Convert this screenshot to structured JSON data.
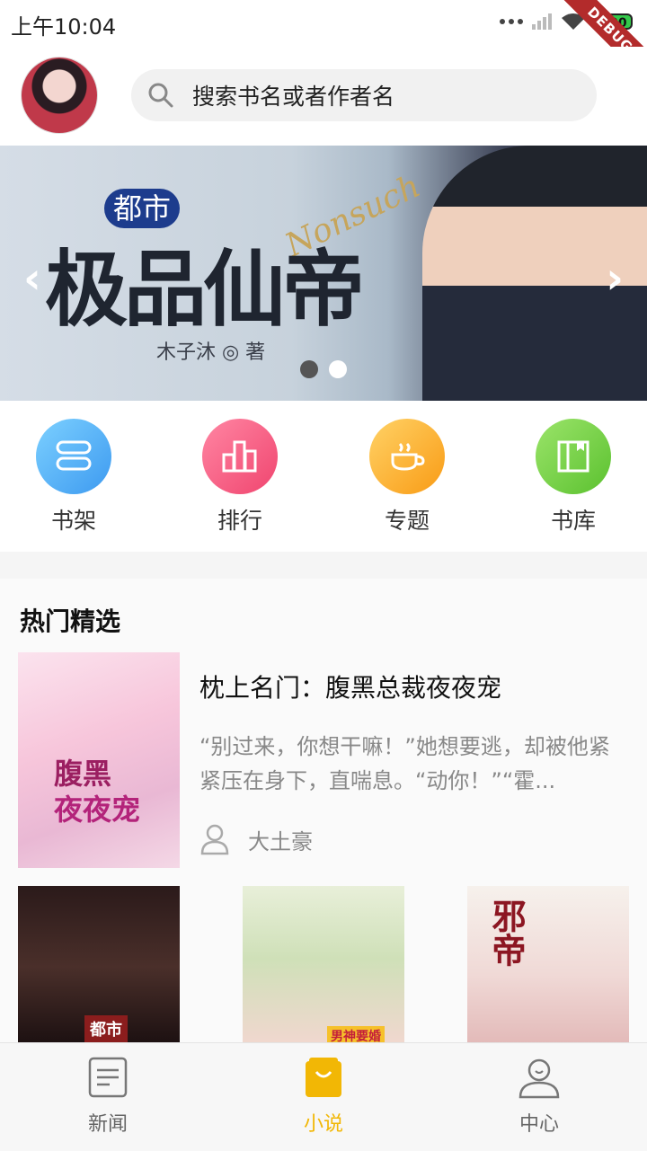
{
  "status_bar": {
    "time": "上午10:04",
    "battery": "100",
    "debug": "DEBUG"
  },
  "search": {
    "placeholder": "搜索书名或者作者名"
  },
  "banner": {
    "tag": "都市",
    "title": "极品仙帝",
    "script_text": "Nonsuch",
    "author": "木子沐 ◎ 著",
    "prev_glyph": "‹",
    "next_glyph": "›",
    "page_count": 2,
    "active_page": 1
  },
  "categories": [
    {
      "label": "书架",
      "icon": "bookshelf-icon",
      "color": "#5fb8f5"
    },
    {
      "label": "排行",
      "icon": "ranking-icon",
      "color": "#f7658a"
    },
    {
      "label": "专题",
      "icon": "coffee-cup-icon",
      "color": "#fbb32b"
    },
    {
      "label": "书库",
      "icon": "library-book-icon",
      "color": "#7dd34a"
    }
  ],
  "hot": {
    "section_title": "热门精选",
    "featured": {
      "name": "枕上名门：腹黑总裁夜夜宠",
      "description": "“别过来，你想干嘛！”她想要逃，却被他紧紧压在身下，直喘息。“动你！”“霍...",
      "author": "大土豪",
      "cover_text_1": "腹黑",
      "cover_text_2": "夜夜宠"
    },
    "covers": [
      {
        "text": "都市"
      },
      {
        "text": "男神要婚"
      },
      {
        "text": "邪帝"
      }
    ]
  },
  "nav": [
    {
      "label": "新闻",
      "icon": "news-icon",
      "active": false
    },
    {
      "label": "小说",
      "icon": "novel-bag-icon",
      "active": true
    },
    {
      "label": "中心",
      "icon": "user-center-icon",
      "active": false
    }
  ],
  "colors": {
    "accent": "#f2b705",
    "nav_text": "#666666"
  }
}
